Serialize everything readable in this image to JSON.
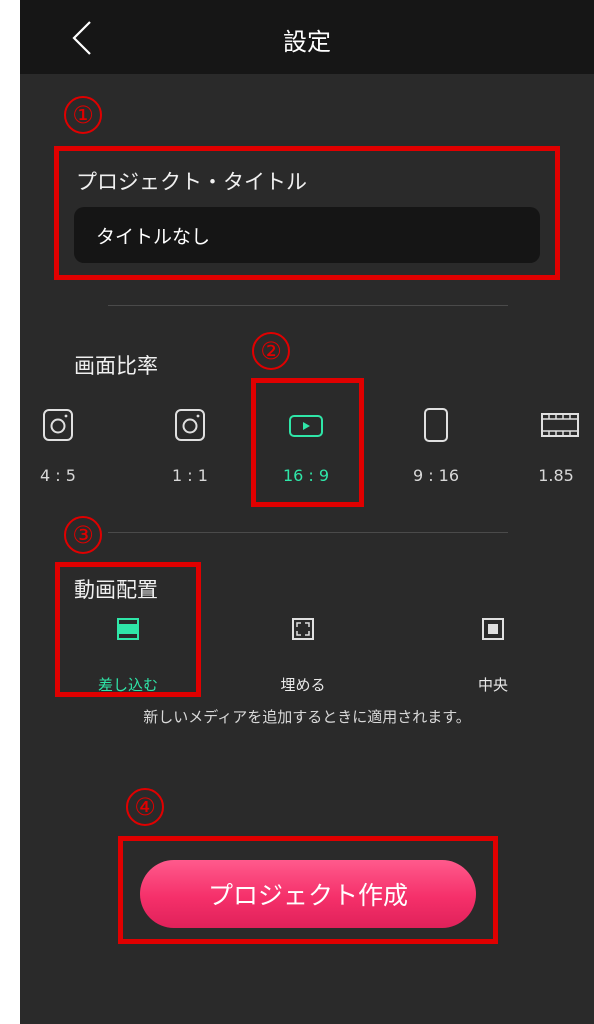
{
  "header": {
    "title": "設定",
    "back_icon": "chevron-left-icon"
  },
  "annotations": [
    "①",
    "②",
    "③",
    "④"
  ],
  "project_title": {
    "label": "プロジェクト・タイトル",
    "value": "タイトルなし"
  },
  "aspect_ratio": {
    "label": "画面比率",
    "selected": "16 : 9",
    "options": [
      {
        "label": "4 : 5",
        "icon": "instagram-icon"
      },
      {
        "label": "1 : 1",
        "icon": "instagram-icon"
      },
      {
        "label": "16 : 9",
        "icon": "youtube-icon"
      },
      {
        "label": "9 : 16",
        "icon": "portrait-frame-icon"
      },
      {
        "label": "1.85",
        "icon": "film-icon"
      }
    ]
  },
  "video_layout": {
    "label": "動画配置",
    "selected": "差し込む",
    "options": [
      {
        "label": "差し込む",
        "icon": "fit-icon"
      },
      {
        "label": "埋める",
        "icon": "fill-icon"
      },
      {
        "label": "中央",
        "icon": "center-icon"
      }
    ],
    "note": "新しいメディアを追加するときに適用されます。"
  },
  "create_button": {
    "label": "プロジェクト作成"
  },
  "colors": {
    "background": "#2a2a2a",
    "header": "#161616",
    "accent": "#2fe6a8",
    "button": "#f5306a",
    "annotation": "#e00000"
  }
}
